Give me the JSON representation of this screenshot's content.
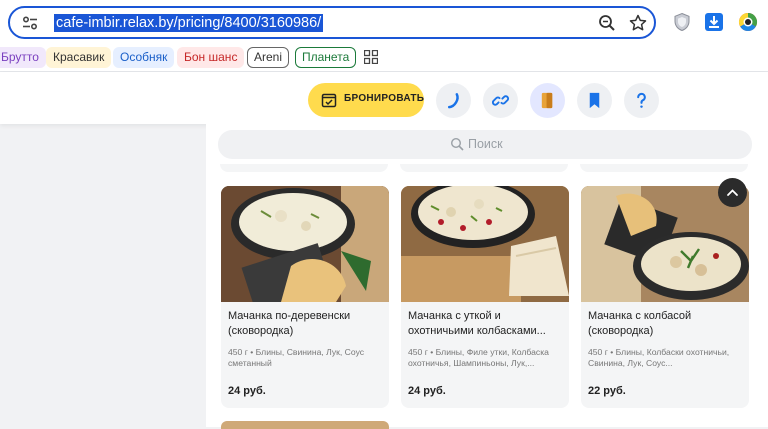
{
  "browser": {
    "url": "cafe-imbir.relax.by/pricing/8400/3160986/"
  },
  "bookmarks": [
    {
      "label": "Брутто",
      "color": "#7a3fbf",
      "bg": "#f1e8fb"
    },
    {
      "label": "Красавик",
      "color": "#333333",
      "bg": "#fff4d6"
    },
    {
      "label": "Особняк",
      "color": "#1a5fc9",
      "bg": "#e6efff"
    },
    {
      "label": "Бон шанс",
      "color": "#c62828",
      "bg": "#ffe8e8"
    },
    {
      "label": "Areni",
      "color": "#333333",
      "bg": "#ffffff",
      "border": "#666666"
    },
    {
      "label": "Планета",
      "color": "#1b7a3a",
      "bg": "#ffffff",
      "border": "#1b7a3a"
    }
  ],
  "header": {
    "book_label": "БРОНИРОВАТЬ",
    "accent": "#ffdb4d"
  },
  "search": {
    "placeholder": "Поиск"
  },
  "cards": [
    {
      "name": "Мачанка по-деревенски (сковородка)",
      "desc": "450 г • Блины, Свинина, Лук, Соус сметанный",
      "price": "24 руб."
    },
    {
      "name": "Мачанка с уткой и охотничьими колбасками...",
      "desc": "450 г • Блины, Филе утки, Колбаска охотничья, Шампиньоны, Лук,...",
      "price": "24 руб."
    },
    {
      "name": "Мачанка с колбасой (сковородка)",
      "desc": "450 г • Блины, Колбаски охотничьи, Свинина, Лук, Соус...",
      "price": "22 руб."
    }
  ]
}
